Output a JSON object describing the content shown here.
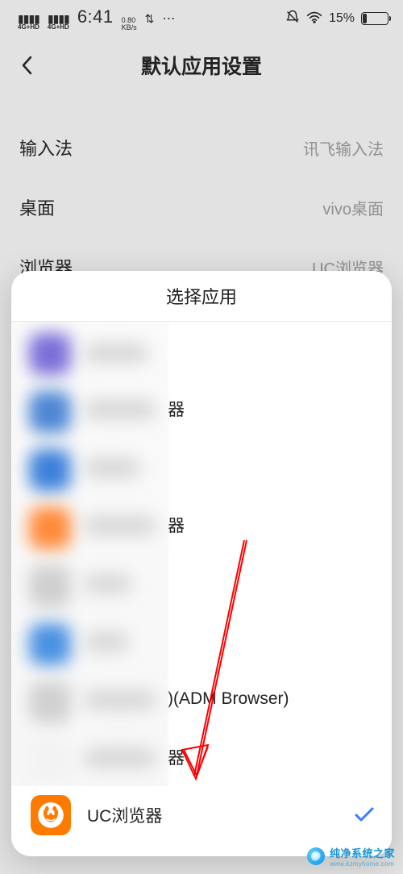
{
  "status_bar": {
    "signal1_label": "4G+HD",
    "signal2_label": "4G+HD",
    "time": "6:41",
    "net_speed": "0.80",
    "net_unit": "KB/s",
    "battery_percent": "15%",
    "battery_level_pct": 15
  },
  "page": {
    "title": "默认应用设置",
    "rows": [
      {
        "label": "输入法",
        "value": "讯飞输入法"
      },
      {
        "label": "桌面",
        "value": "vivo桌面"
      },
      {
        "label": "浏览器",
        "value": "UC浏览器"
      }
    ]
  },
  "sheet": {
    "title": "选择应用",
    "items": [
      {
        "name_visible": "",
        "icon_color": "#6a5acd",
        "blurred": true
      },
      {
        "name_visible": "器",
        "icon_color": "#2e7bd6",
        "blurred": true
      },
      {
        "name_visible": "",
        "icon_color": "#2e7bd6",
        "blurred": true
      },
      {
        "name_visible": "器",
        "icon_color": "#ff7a2a",
        "blurred": true
      },
      {
        "name_visible": "",
        "icon_color": "#bdbdbd",
        "blurred": true
      },
      {
        "name_visible": "",
        "icon_color": "#3b8be0",
        "blurred": true
      },
      {
        "name_visible": ")(ADM Browser)",
        "icon_color": "#c7c7c7",
        "blurred": true
      },
      {
        "name_visible": "器",
        "icon_color": "#ffffff",
        "blurred": true
      },
      {
        "name_visible": "UC浏览器",
        "icon_color": "#ff7a00",
        "blurred": false,
        "selected": true,
        "icon": "uc"
      }
    ]
  },
  "watermark": {
    "cn": "纯净系统之家",
    "en": "www.kzmyhome.com"
  },
  "annotation": {
    "arrow_color": "#ff0000"
  }
}
